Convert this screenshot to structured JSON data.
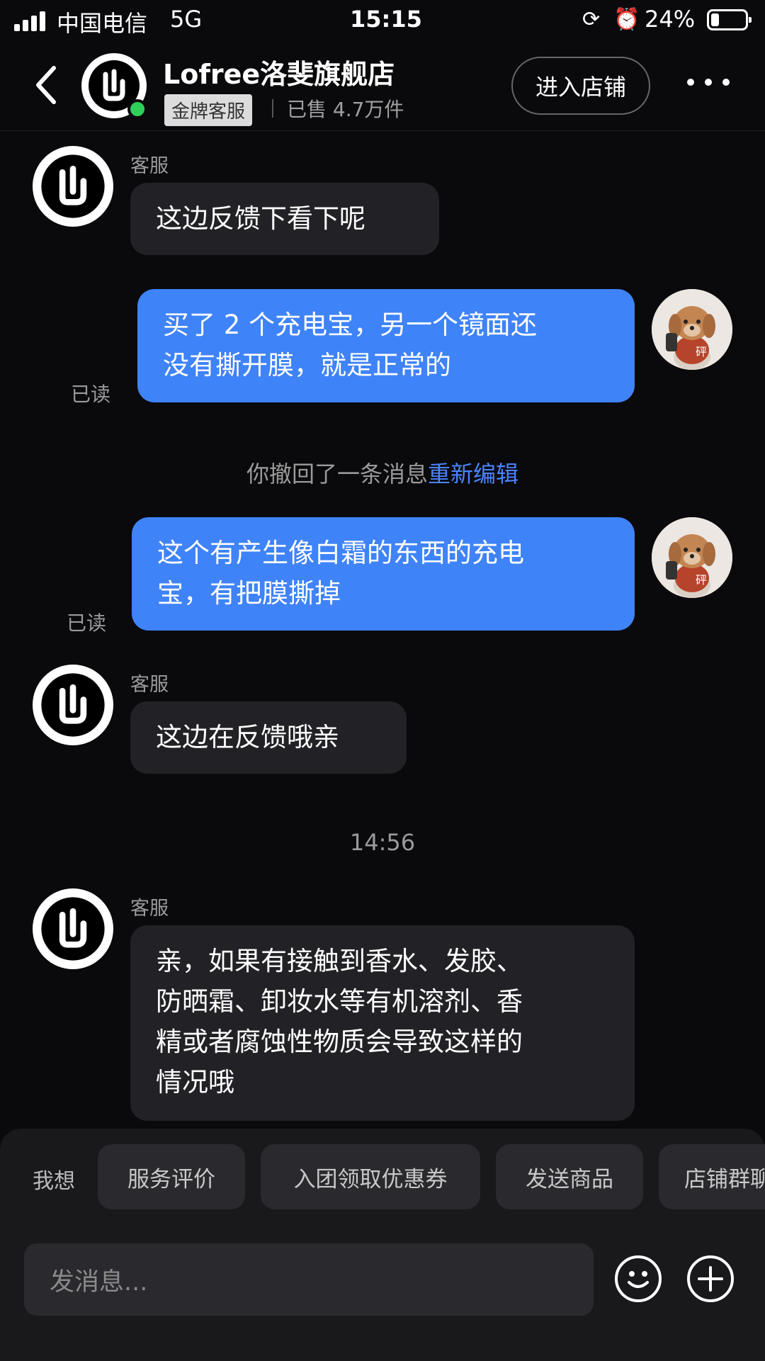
{
  "status_bar": {
    "carrier": "中国电信",
    "network": "5G",
    "time": "15:15",
    "battery_percent": "24%",
    "battery_level": 0.24
  },
  "header": {
    "shop_name": "Lofree洛斐旗舰店",
    "badge": "金牌客服",
    "sold": "已售 4.7万件",
    "enter_shop": "进入店铺"
  },
  "messages": [
    {
      "from": "shop",
      "sender": "客服",
      "text": "这边反馈下看下呢"
    },
    {
      "from": "user",
      "read": "已读",
      "avatar_label": "砰",
      "lines": [
        "买了 2 个充电宝，另一个镜面还",
        "没有撕开膜，就是正常的"
      ]
    },
    {
      "from": "system",
      "text": "你撤回了一条消息",
      "link": "重新编辑"
    },
    {
      "from": "user",
      "read": "已读",
      "avatar_label": "砰",
      "lines": [
        "这个有产生像白霜的东西的充电",
        "宝，有把膜撕掉"
      ]
    },
    {
      "from": "shop",
      "sender": "客服",
      "text": "这边在反馈哦亲"
    },
    {
      "from": "time",
      "text": "14:56"
    },
    {
      "from": "shop",
      "sender": "客服",
      "lines": [
        "亲，如果有接触到香水、发胶、",
        "防晒霜、卸妆水等有机溶剂、香",
        "精或者腐蚀性物质会导致这样的",
        "情况哦"
      ]
    }
  ],
  "quick_actions": {
    "label": "我想",
    "chips": [
      "服务评价",
      "入团领取优惠券",
      "发送商品",
      "店铺群聊"
    ]
  },
  "composer": {
    "placeholder": "发消息..."
  },
  "icons": [
    "signal-icon",
    "back-icon",
    "shop-logo-icon",
    "more-icon",
    "emoji-icon",
    "plus-icon"
  ]
}
